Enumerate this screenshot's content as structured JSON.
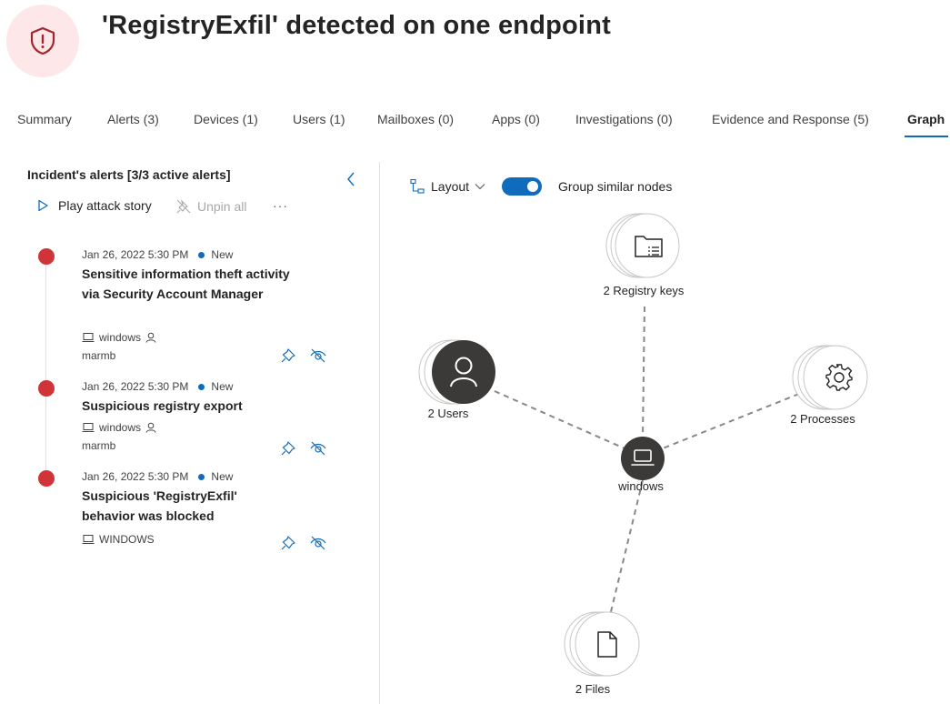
{
  "header": {
    "title": "'RegistryExfil' detected on one endpoint",
    "icon": "shield-alert-icon",
    "icon_color": "#a4262c",
    "icon_bg": "#fde7e9"
  },
  "tabs": [
    {
      "label": "Summary"
    },
    {
      "label": "Alerts (3)"
    },
    {
      "label": "Devices (1)"
    },
    {
      "label": "Users (1)"
    },
    {
      "label": "Mailboxes (0)"
    },
    {
      "label": "Apps (0)"
    },
    {
      "label": "Investigations (0)"
    },
    {
      "label": "Evidence and Response (5)"
    },
    {
      "label": "Graph",
      "active": true
    }
  ],
  "alerts_panel": {
    "title": "Incident's alerts [3/3 active alerts]",
    "play_label": "Play attack story",
    "unpin_label": "Unpin all",
    "more_label": "···",
    "alerts": [
      {
        "date": "Jan 26, 2022 5:30 PM",
        "status": "New",
        "title": "Sensitive information theft activity via Security Account Manager",
        "device": "windows",
        "user": "marmb",
        "severity_color": "#d13438"
      },
      {
        "date": "Jan 26, 2022 5:30 PM",
        "status": "New",
        "title": "Suspicious registry export",
        "device": "windows",
        "user": "marmb",
        "severity_color": "#d13438"
      },
      {
        "date": "Jan 26, 2022 5:30 PM",
        "status": "New",
        "title": "Suspicious 'RegistryExfil' behavior was blocked",
        "device": "WINDOWS",
        "user": "",
        "severity_color": "#d13438"
      }
    ]
  },
  "graph_toolbar": {
    "layout_label": "Layout",
    "group_label": "Group similar nodes",
    "group_enabled": true
  },
  "graph": {
    "nodes": [
      {
        "id": "registry",
        "label": "2 Registry keys",
        "icon": "registry-folder-icon"
      },
      {
        "id": "users",
        "label": "2 Users",
        "icon": "user-icon"
      },
      {
        "id": "processes",
        "label": "2 Processes",
        "icon": "gear-icon"
      },
      {
        "id": "device",
        "label": "windows",
        "icon": "laptop-icon"
      },
      {
        "id": "files",
        "label": "2 Files",
        "icon": "file-icon"
      }
    ]
  },
  "colors": {
    "accent": "#0f6cbd",
    "severity_high": "#d13438",
    "dark_node": "#3b3a39"
  }
}
